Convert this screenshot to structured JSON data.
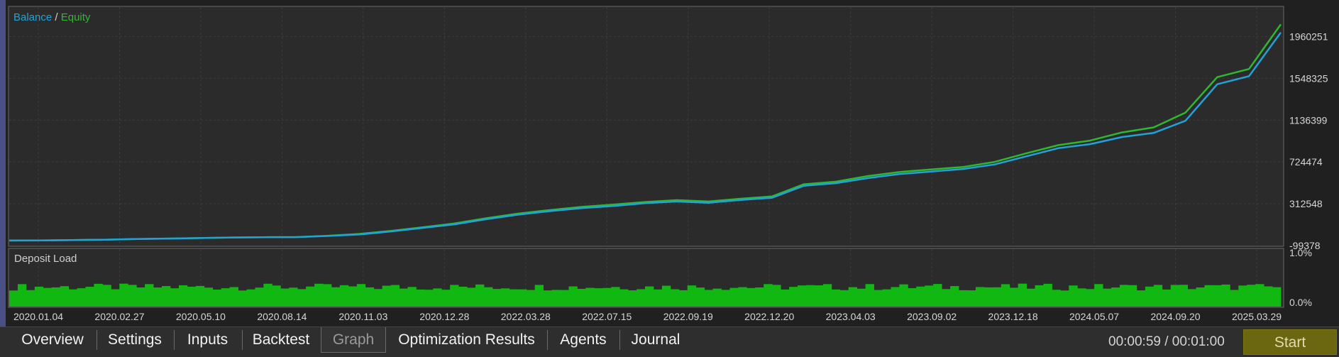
{
  "graph": {
    "legend": {
      "balance": "Balance",
      "separator": " / ",
      "equity": "Equity"
    },
    "deposit_load_label": "Deposit Load",
    "colors": {
      "balance": "#1fa3d9",
      "equity": "#2fb82f",
      "deposit_load": "#12b812",
      "grid": "#3c3c3c"
    }
  },
  "chart_data": [
    {
      "type": "line",
      "title": "",
      "legend": [
        "Balance",
        "Equity"
      ],
      "grid": true,
      "yticks": [
        "1960251",
        "1548325",
        "1136399",
        "724474",
        "312548",
        "-99378"
      ],
      "ylim": [
        -99378,
        2250000
      ],
      "xticks": [
        "2020.01.04",
        "2020.02.27",
        "2020.05.10",
        "2020.08.14",
        "2020.11.03",
        "2020.12.28",
        "2022.03.28",
        "2022.07.15",
        "2022.09.19",
        "2022.12.20",
        "2023.04.03",
        "2023.09.02",
        "2023.12.18",
        "2024.05.07",
        "2024.09.20",
        "2025.03.29"
      ],
      "x": [
        0,
        4,
        8,
        12,
        16,
        20,
        24,
        28,
        32,
        36,
        40,
        44,
        48,
        52,
        56,
        60,
        64,
        68,
        72,
        76,
        80,
        84,
        88,
        92,
        96,
        100,
        104,
        108,
        112,
        116,
        120,
        124,
        128,
        132,
        136,
        140,
        144,
        148,
        152,
        156,
        160
      ],
      "series": [
        {
          "name": "Balance",
          "values": [
            -50000,
            -48000,
            -45000,
            -41000,
            -35000,
            -30000,
            -25000,
            -20000,
            -17000,
            -16000,
            -5000,
            10000,
            40000,
            75000,
            110000,
            160000,
            205000,
            240000,
            270000,
            290000,
            318000,
            335000,
            322000,
            350000,
            372000,
            490000,
            515000,
            565000,
            605000,
            630000,
            655000,
            700000,
            780000,
            860000,
            900000,
            970000,
            1010000,
            1130000,
            1490000,
            1570000,
            2000000
          ]
        },
        {
          "name": "Equity",
          "values": [
            -50000,
            -48000,
            -45000,
            -41000,
            -35000,
            -30000,
            -25000,
            -20000,
            -17000,
            -16000,
            -3000,
            15000,
            45000,
            80000,
            118000,
            170000,
            215000,
            250000,
            282000,
            305000,
            330000,
            348000,
            335000,
            362000,
            385000,
            505000,
            530000,
            585000,
            625000,
            650000,
            675000,
            725000,
            810000,
            890000,
            935000,
            1015000,
            1065000,
            1210000,
            1560000,
            1640000,
            2080000
          ]
        }
      ]
    },
    {
      "type": "bar",
      "title": "Deposit Load",
      "ylim": [
        0,
        1.0
      ],
      "yticks": [
        "1.0%",
        "0.0%"
      ],
      "bar_count": 150,
      "level_range_percent": [
        0.28,
        0.4
      ]
    }
  ],
  "tabs": [
    {
      "label": "Overview",
      "active": false
    },
    {
      "label": "Settings",
      "active": false
    },
    {
      "label": "Inputs",
      "active": false
    },
    {
      "label": "Backtest",
      "active": false
    },
    {
      "label": "Graph",
      "active": true
    },
    {
      "label": "Optimization Results",
      "active": false
    },
    {
      "label": "Agents",
      "active": false
    },
    {
      "label": "Journal",
      "active": false
    }
  ],
  "status": {
    "timer": "00:00:59 / 00:01:00",
    "start_label": "Start"
  }
}
